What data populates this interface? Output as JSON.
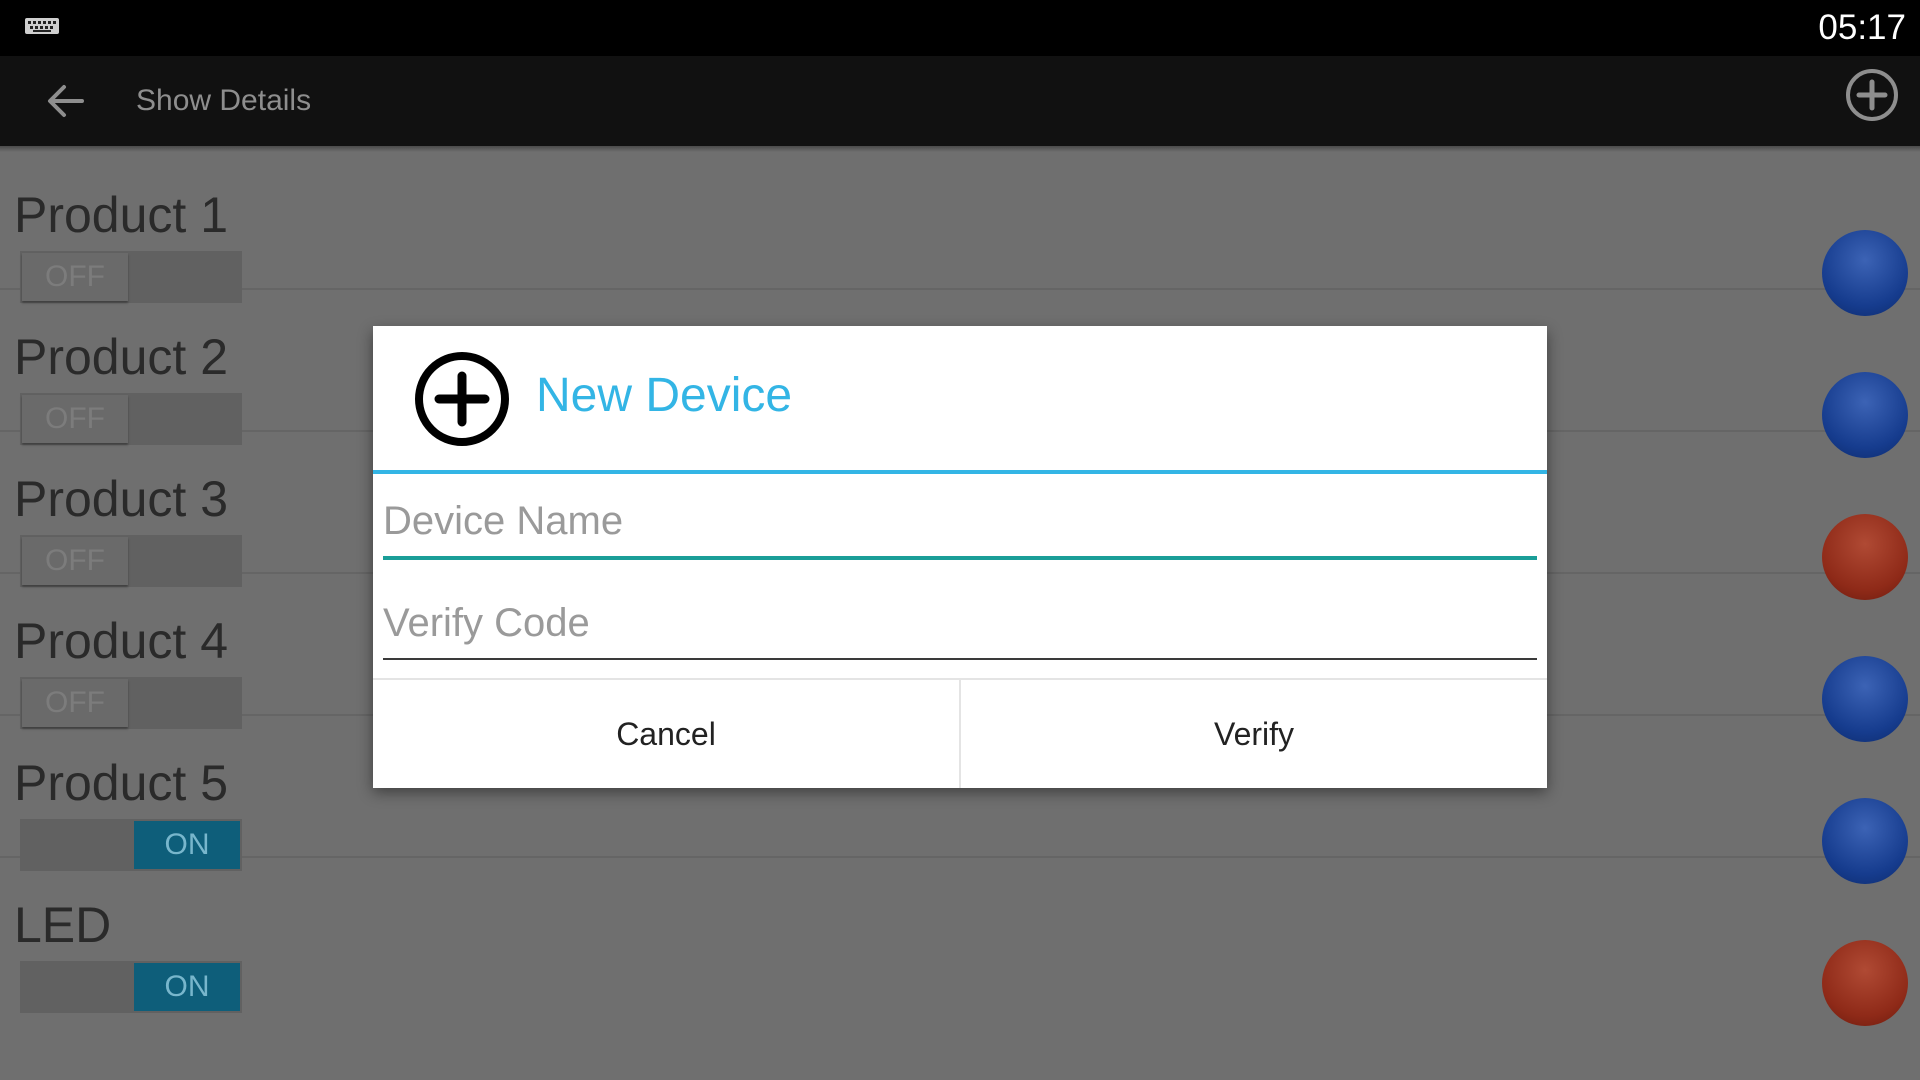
{
  "status_bar": {
    "time": "05:17",
    "keyboard_icon": "keyboard-icon"
  },
  "action_bar": {
    "title": "Show Details",
    "back_icon": "arrow-left-icon",
    "add_icon": "plus-circle-icon"
  },
  "devices": [
    {
      "name": "Product 1",
      "state": "OFF",
      "indicator": "blue"
    },
    {
      "name": "Product 2",
      "state": "OFF",
      "indicator": "blue"
    },
    {
      "name": "Product 3",
      "state": "OFF",
      "indicator": "red"
    },
    {
      "name": "Product 4",
      "state": "OFF",
      "indicator": "blue"
    },
    {
      "name": "Product 5",
      "state": "ON",
      "indicator": "blue"
    },
    {
      "name": "LED",
      "state": "ON",
      "indicator": "red"
    }
  ],
  "dialog": {
    "icon": "plus-circle-icon",
    "title": "New Device",
    "device_name_placeholder": "Device Name",
    "device_name_value": "",
    "verify_code_placeholder": "Verify Code",
    "verify_code_value": "",
    "cancel_label": "Cancel",
    "verify_label": "Verify"
  },
  "colors": {
    "accent": "#33b5e5",
    "focus_underline": "#1a9e98",
    "toggle_on": "#0e5e7a",
    "indicator_blue": "#1e4aa0",
    "indicator_red": "#9a3220"
  }
}
